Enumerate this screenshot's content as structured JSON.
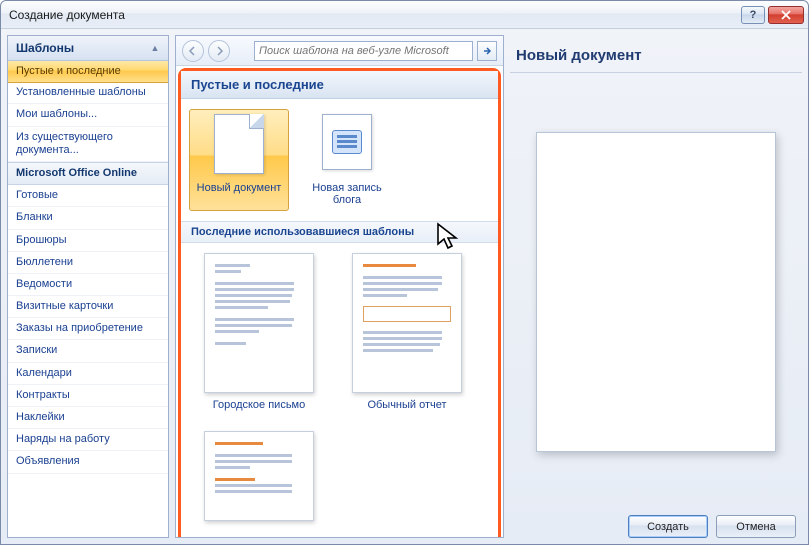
{
  "window": {
    "title": "Создание документа"
  },
  "sidebar": {
    "header": "Шаблоны",
    "items": [
      {
        "label": "Пустые и последние",
        "selected": true
      },
      {
        "label": "Установленные шаблоны"
      },
      {
        "label": "Мои шаблоны..."
      },
      {
        "label": "Из существующего документа..."
      },
      {
        "label": "Microsoft Office Online",
        "category": true
      },
      {
        "label": "Готовые"
      },
      {
        "label": "Бланки"
      },
      {
        "label": "Брошюры"
      },
      {
        "label": "Бюллетени"
      },
      {
        "label": "Ведомости"
      },
      {
        "label": "Визитные карточки"
      },
      {
        "label": "Заказы на приобретение"
      },
      {
        "label": "Записки"
      },
      {
        "label": "Календари"
      },
      {
        "label": "Контракты"
      },
      {
        "label": "Наклейки"
      },
      {
        "label": "Наряды на работу"
      },
      {
        "label": "Объявления"
      }
    ]
  },
  "toolbar": {
    "search_placeholder": "Поиск шаблона на веб-узле Microsoft"
  },
  "main": {
    "heading": "Пустые и последние",
    "tiles": [
      {
        "label": "Новый документ",
        "selected": true,
        "kind": "blank"
      },
      {
        "label": "Новая запись блога",
        "kind": "blog"
      }
    ],
    "recent_heading": "Последние использовавшиеся шаблоны",
    "recent": [
      {
        "label": "Городское письмо"
      },
      {
        "label": "Обычный отчет"
      },
      {
        "label": ""
      }
    ]
  },
  "preview": {
    "title": "Новый документ"
  },
  "buttons": {
    "create": "Создать",
    "cancel": "Отмена"
  }
}
